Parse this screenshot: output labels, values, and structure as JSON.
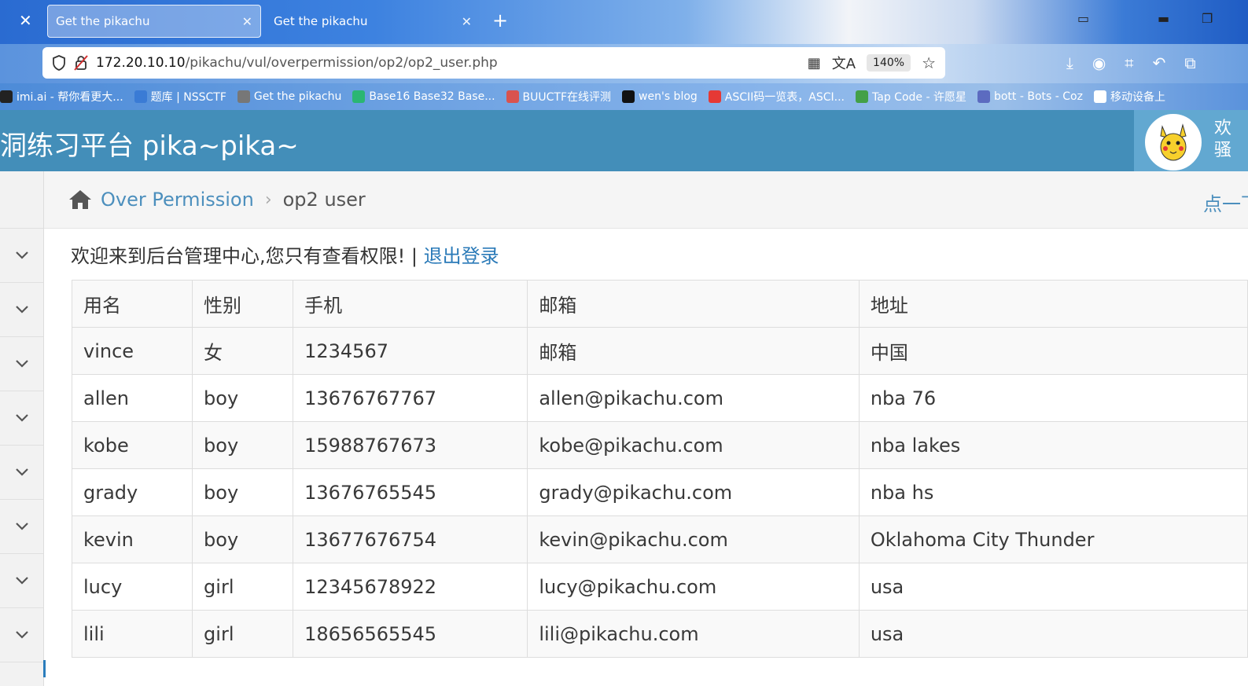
{
  "browser": {
    "tabs": [
      {
        "title": "Get the pikachu",
        "active": true
      },
      {
        "title": "Get the pikachu",
        "active": false
      }
    ],
    "url_host": "172.20.10.10",
    "url_path": "/pikachu/vul/overpermission/op2/op2_user.php",
    "zoom": "140%",
    "bookmarks": [
      {
        "label": "imi.ai - 帮你看更大...",
        "icon": "kimi-icon",
        "color": "#222222"
      },
      {
        "label": "题库 | NSSCTF",
        "icon": "nssctf-icon",
        "color": "#3a7bd5"
      },
      {
        "label": "Get the pikachu",
        "icon": "globe-icon",
        "color": "#777777"
      },
      {
        "label": "Base16 Base32 Base...",
        "icon": "t-icon",
        "color": "#2bb673"
      },
      {
        "label": "BUUCTF在线评测",
        "icon": "buuctf-icon",
        "color": "#d9534f"
      },
      {
        "label": "wen's blog",
        "icon": "n-icon",
        "color": "#111111"
      },
      {
        "label": "ASCII码一览表，ASCI...",
        "icon": "c-icon",
        "color": "#e53935"
      },
      {
        "label": "Tap Code - 许愿星",
        "icon": "star-icon",
        "color": "#43a047"
      },
      {
        "label": "bott - Bots - Coz",
        "icon": "bot-icon",
        "color": "#5c6bc0"
      },
      {
        "label": "移动设备上",
        "icon": "mobile-icon",
        "color": "#ffffff"
      }
    ]
  },
  "header": {
    "title": "洞练习平台 pika~pika~",
    "user_line1": "欢",
    "user_line2": "骚"
  },
  "breadcrumb": {
    "section": "Over Permission",
    "current": "op2 user",
    "right_link": "点一下提示"
  },
  "welcome": {
    "message": "欢迎来到后台管理中心,您只有查看权限! | ",
    "logout": "退出登录"
  },
  "table": {
    "headers": [
      "用名",
      "性别",
      "手机",
      "邮箱",
      "地址"
    ],
    "rows": [
      [
        "vince",
        "女",
        "1234567",
        "邮箱",
        "中国"
      ],
      [
        "allen",
        "boy",
        "13676767767",
        "allen@pikachu.com",
        "nba 76"
      ],
      [
        "kobe",
        "boy",
        "15988767673",
        "kobe@pikachu.com",
        "nba lakes"
      ],
      [
        "grady",
        "boy",
        "13676765545",
        "grady@pikachu.com",
        "nba hs"
      ],
      [
        "kevin",
        "boy",
        "13677676754",
        "kevin@pikachu.com",
        "Oklahoma City Thunder"
      ],
      [
        "lucy",
        "girl",
        "12345678922",
        "lucy@pikachu.com",
        "usa"
      ],
      [
        "lili",
        "girl",
        "18656565545",
        "lili@pikachu.com",
        "usa"
      ]
    ]
  },
  "sidebar": {
    "items": [
      "chevron-down-icon",
      "chevron-down-icon",
      "chevron-down-icon",
      "chevron-down-icon",
      "chevron-down-icon",
      "chevron-down-icon",
      "chevron-down-icon",
      "chevron-down-icon"
    ]
  }
}
